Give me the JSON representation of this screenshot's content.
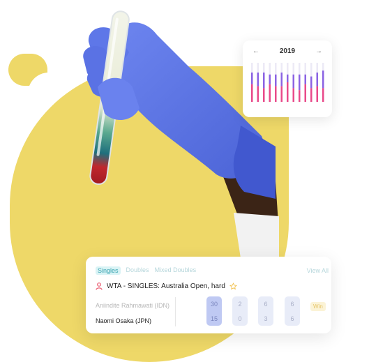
{
  "chart_card": {
    "year": "2019",
    "prev_arrow": "←",
    "next_arrow": "→",
    "chart_data": {
      "type": "bar",
      "colors": {
        "upper": "#8b63e3",
        "lower": "#e94a8a"
      },
      "bars": [
        {
          "upper": 0.3,
          "lower": 0.45
        },
        {
          "upper": 0.35,
          "lower": 0.4
        },
        {
          "upper": 0.4,
          "lower": 0.35
        },
        {
          "upper": 0.25,
          "lower": 0.45
        },
        {
          "upper": 0.3,
          "lower": 0.4
        },
        {
          "upper": 0.35,
          "lower": 0.4
        },
        {
          "upper": 0.2,
          "lower": 0.5
        },
        {
          "upper": 0.35,
          "lower": 0.35
        },
        {
          "upper": 0.4,
          "lower": 0.3
        },
        {
          "upper": 0.25,
          "lower": 0.45
        },
        {
          "upper": 0.3,
          "lower": 0.35
        },
        {
          "upper": 0.35,
          "lower": 0.4
        },
        {
          "upper": 0.45,
          "lower": 0.35
        }
      ]
    }
  },
  "match": {
    "tabs": [
      {
        "label": "Singles",
        "active": true
      },
      {
        "label": "Doubles",
        "active": false
      },
      {
        "label": "Mixed Doubles",
        "active": false
      }
    ],
    "view_all": "View All",
    "event": "WTA - SINGLES: Australia Open, hard",
    "players": [
      {
        "name": "Aniindite Rahmawati (IDN)"
      },
      {
        "name": "Naomi Osaka (JPN)"
      }
    ],
    "sets": [
      {
        "p1": "30",
        "p2": "15"
      },
      {
        "p1": "2",
        "p2": "0"
      },
      {
        "p1": "6",
        "p2": "3"
      },
      {
        "p1": "6",
        "p2": "6"
      }
    ],
    "win_label": "Win"
  }
}
